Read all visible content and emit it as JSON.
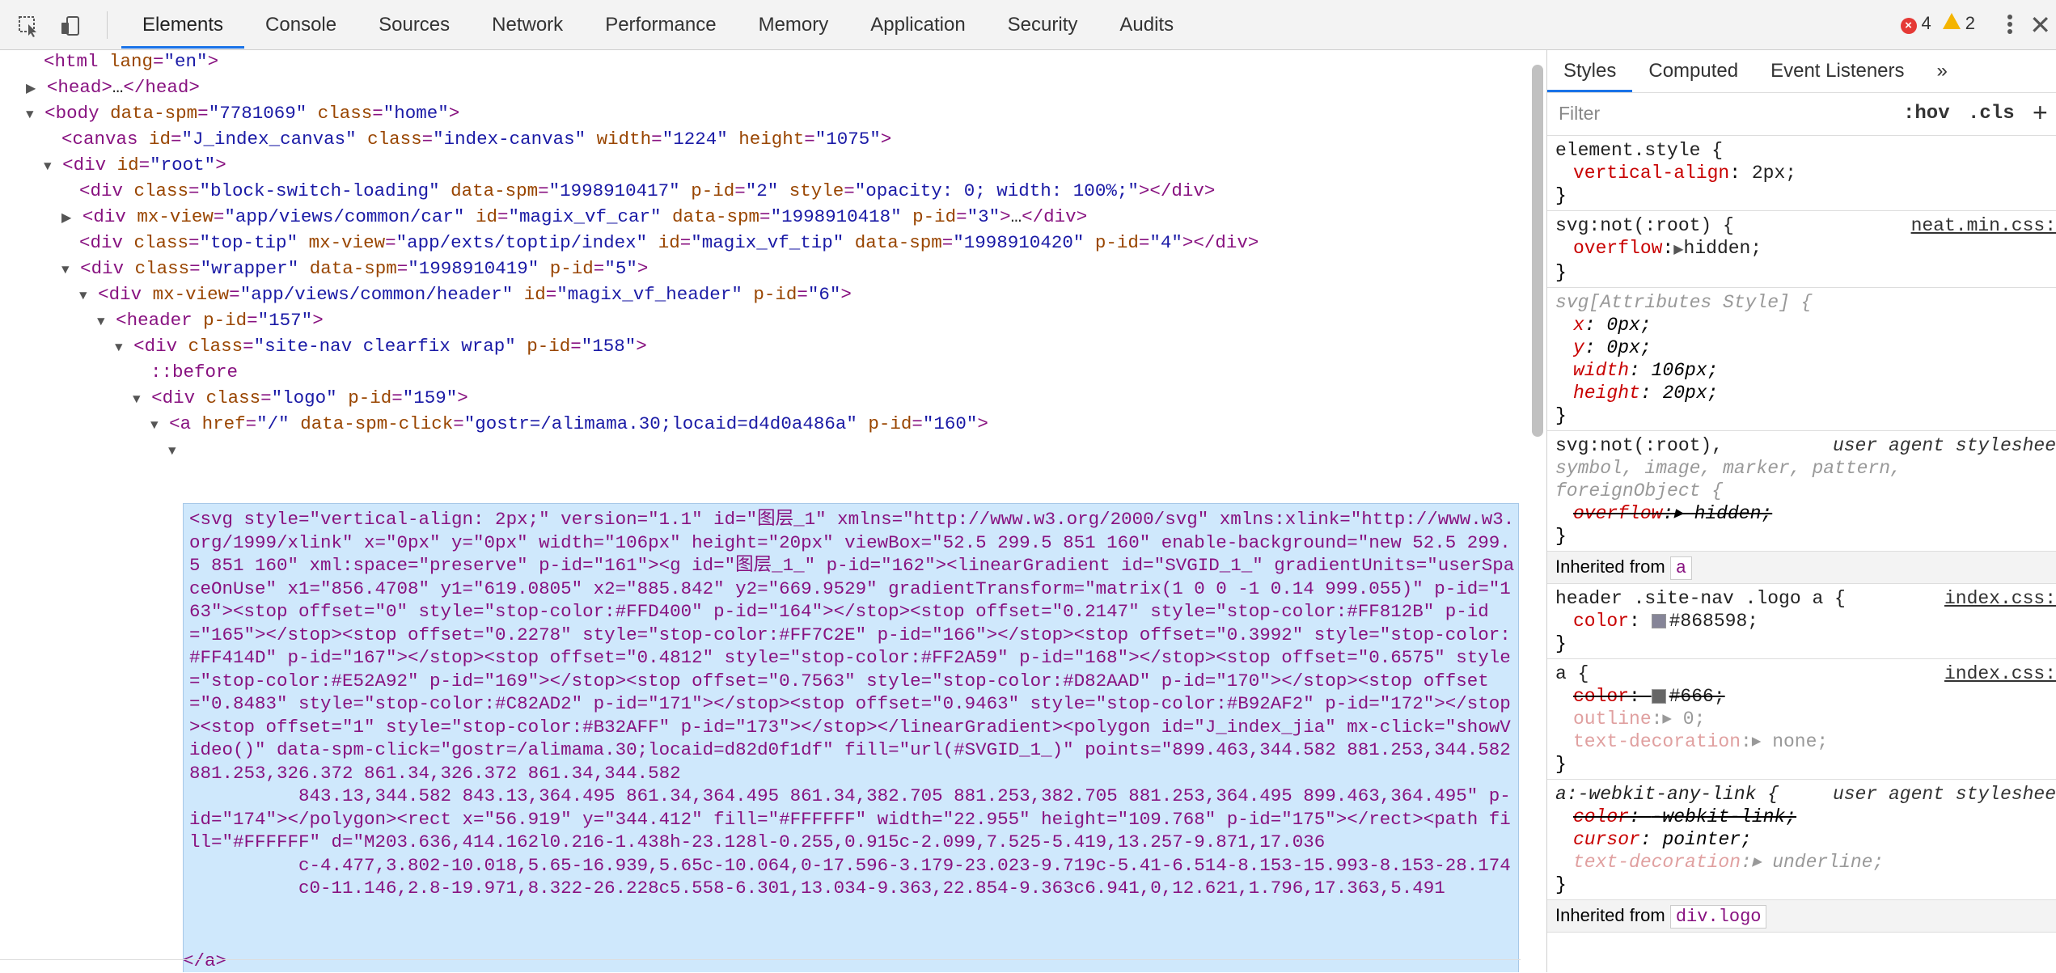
{
  "toolbar": {
    "tabs": [
      "Elements",
      "Console",
      "Sources",
      "Network",
      "Performance",
      "Memory",
      "Application",
      "Security",
      "Audits"
    ],
    "errors": "4",
    "warnings": "2"
  },
  "dom": {
    "lines": [
      {
        "indent": 0,
        "arrow": "",
        "html": "<html lang=\"en\">"
      },
      {
        "indent": 0,
        "arrow": "▶",
        "html": "<head>…</head>"
      },
      {
        "indent": 0,
        "arrow": "▼",
        "html": "<body data-spm=\"7781069\" class=\"home\">"
      },
      {
        "indent": 1,
        "arrow": "",
        "html": "<canvas id=\"J_index_canvas\" class=\"index-canvas\" width=\"1224\" height=\"1075\">"
      },
      {
        "indent": 1,
        "arrow": "▼",
        "html": "<div id=\"root\">"
      },
      {
        "indent": 2,
        "arrow": "",
        "html": "<div class=\"block-switch-loading\" data-spm=\"1998910417\" p-id=\"2\" style=\"opacity: 0; width: 100%;\"></div>"
      },
      {
        "indent": 2,
        "arrow": "▶",
        "html": "<div mx-view=\"app/views/common/car\" id=\"magix_vf_car\" data-spm=\"1998910418\" p-id=\"3\">…</div>"
      },
      {
        "indent": 2,
        "arrow": "",
        "html": "<div class=\"top-tip\" mx-view=\"app/exts/toptip/index\" id=\"magix_vf_tip\" data-spm=\"1998910420\" p-id=\"4\"></div>"
      },
      {
        "indent": 2,
        "arrow": "▼",
        "html": "<div class=\"wrapper\" data-spm=\"1998910419\" p-id=\"5\">"
      },
      {
        "indent": 3,
        "arrow": "▼",
        "html": "<div mx-view=\"app/views/common/header\" id=\"magix_vf_header\" p-id=\"6\">"
      },
      {
        "indent": 4,
        "arrow": "▼",
        "html": "<header p-id=\"157\">"
      },
      {
        "indent": 5,
        "arrow": "▼",
        "html": "<div class=\"site-nav clearfix wrap\" p-id=\"158\">"
      },
      {
        "indent": 6,
        "arrow": "",
        "html": "::before"
      },
      {
        "indent": 6,
        "arrow": "▼",
        "html": "<div class=\"logo\" p-id=\"159\">"
      },
      {
        "indent": 7,
        "arrow": "▼",
        "html": "<a href=\"/\" data-spm-click=\"gostr=/alimama.30;locaid=d4d0a486a\" p-id=\"160\">"
      },
      {
        "indent": 8,
        "arrow": "▼",
        "html": ""
      }
    ],
    "selected_text": "<svg style=\"vertical-align: 2px;\" version=\"1.1\" id=\"图层_1\" xmlns=\"http://www.w3.org/2000/svg\" xmlns:xlink=\"http://www.w3.org/1999/xlink\" x=\"0px\" y=\"0px\" width=\"106px\" height=\"20px\" viewBox=\"52.5 299.5 851 160\" enable-background=\"new 52.5 299.5 851 160\" xml:space=\"preserve\" p-id=\"161\"><g id=\"图层_1_\" p-id=\"162\"><linearGradient id=\"SVGID_1_\" gradientUnits=\"userSpaceOnUse\" x1=\"856.4708\" y1=\"619.0805\" x2=\"885.842\" y2=\"669.9529\" gradientTransform=\"matrix(1 0 0 -1 0.14 999.055)\" p-id=\"163\"><stop offset=\"0\" style=\"stop-color:#FFD400\" p-id=\"164\"></stop><stop offset=\"0.2147\" style=\"stop-color:#FF812B\" p-id=\"165\"></stop><stop offset=\"0.2278\" style=\"stop-color:#FF7C2E\" p-id=\"166\"></stop><stop offset=\"0.3992\" style=\"stop-color:#FF414D\" p-id=\"167\"></stop><stop offset=\"0.4812\" style=\"stop-color:#FF2A59\" p-id=\"168\"></stop><stop offset=\"0.6575\" style=\"stop-color:#E52A92\" p-id=\"169\"></stop><stop offset=\"0.7563\" style=\"stop-color:#D82AAD\" p-id=\"170\"></stop><stop offset=\"0.8483\" style=\"stop-color:#C82AD2\" p-id=\"171\"></stop><stop offset=\"0.9463\" style=\"stop-color:#B92AF2\" p-id=\"172\"></stop><stop offset=\"1\" style=\"stop-color:#B32AFF\" p-id=\"173\"></stop></linearGradient><polygon id=\"J_index_jia\" mx-click=\"showVideo()\" data-spm-click=\"gostr=/alimama.30;locaid=d82d0f1df\" fill=\"url(#SVGID_1_)\" points=\"899.463,344.582 881.253,344.582 881.253,326.372 861.34,326.372 861.34,344.582\n          843.13,344.582 843.13,364.495 861.34,364.495 861.34,382.705 881.253,382.705 881.253,364.495 899.463,364.495\" p-id=\"174\"></polygon><rect x=\"56.919\" y=\"344.412\" fill=\"#FFFFFF\" width=\"22.955\" height=\"109.768\" p-id=\"175\"></rect><path fill=\"#FFFFFF\" d=\"M203.636,414.162l0.216-1.438h-23.128l-0.255,0.915c-2.099,7.525-5.419,13.257-9.871,17.036\n          c-4.477,3.802-10.018,5.65-16.939,5.65c-10.064,0-17.596-3.179-23.023-9.719c-5.41-6.514-8.153-15.993-8.153-28.174\n          c0-11.146,2.8-19.971,8.322-26.228c5.558-6.301,13.034-9.363,22.854-9.363c6.941,0,12.621,1.796,17.363,5.491",
    "closing": "</a>"
  },
  "styles": {
    "tabs": [
      "Styles",
      "Computed",
      "Event Listeners",
      "»"
    ],
    "filter_placeholder": "Filter",
    "hov": ":hov",
    "cls": ".cls",
    "rules": {
      "r1_sel": "element.style {",
      "r1_prop": "vertical-align",
      "r1_val": "2px;",
      "r2_sel": "svg:not(:root) {",
      "r2_src": "neat.min.css:",
      "r2_prop": "overflow",
      "r2_val": "hidden;",
      "r3_sel": "svg[Attributes Style] {",
      "r3_p1": "x",
      "r3_v1": "0px;",
      "r3_p2": "y",
      "r3_v2": "0px;",
      "r3_p3": "width",
      "r3_v3": "106px;",
      "r3_p4": "height",
      "r3_v4": "20px;",
      "r4_sel1": "svg:not(:root),",
      "r4_sel2": "symbol, image, marker, pattern,",
      "r4_sel3": "foreignObject {",
      "r4_ua": "user agent styleshee",
      "r4_prop": "overflow",
      "r4_val": "hidden;",
      "inh1_label": "Inherited from",
      "inh1_chip": "a",
      "r5_sel": "header .site-nav .logo a {",
      "r5_src": "index.css:",
      "r5_prop": "color",
      "r5_val": "#868598;",
      "r6_sel": "a {",
      "r6_src": "index.css:",
      "r6_p1": "color",
      "r6_v1": "#666;",
      "r6_p2": "outline",
      "r6_v2": "0;",
      "r6_p3": "text-decoration",
      "r6_v3": "none;",
      "r7_sel": "a:-webkit-any-link {",
      "r7_ua": "user agent styleshee",
      "r7_p1": "color",
      "r7_v1": "-webkit-link;",
      "r7_p2": "cursor",
      "r7_v2": "pointer;",
      "r7_p3": "text-decoration",
      "r7_v3": "underline;",
      "inh2_label": "Inherited from",
      "inh2_chip": "div.logo"
    }
  },
  "colors": {
    "swatch1": "#868598",
    "swatch2": "#666666"
  }
}
